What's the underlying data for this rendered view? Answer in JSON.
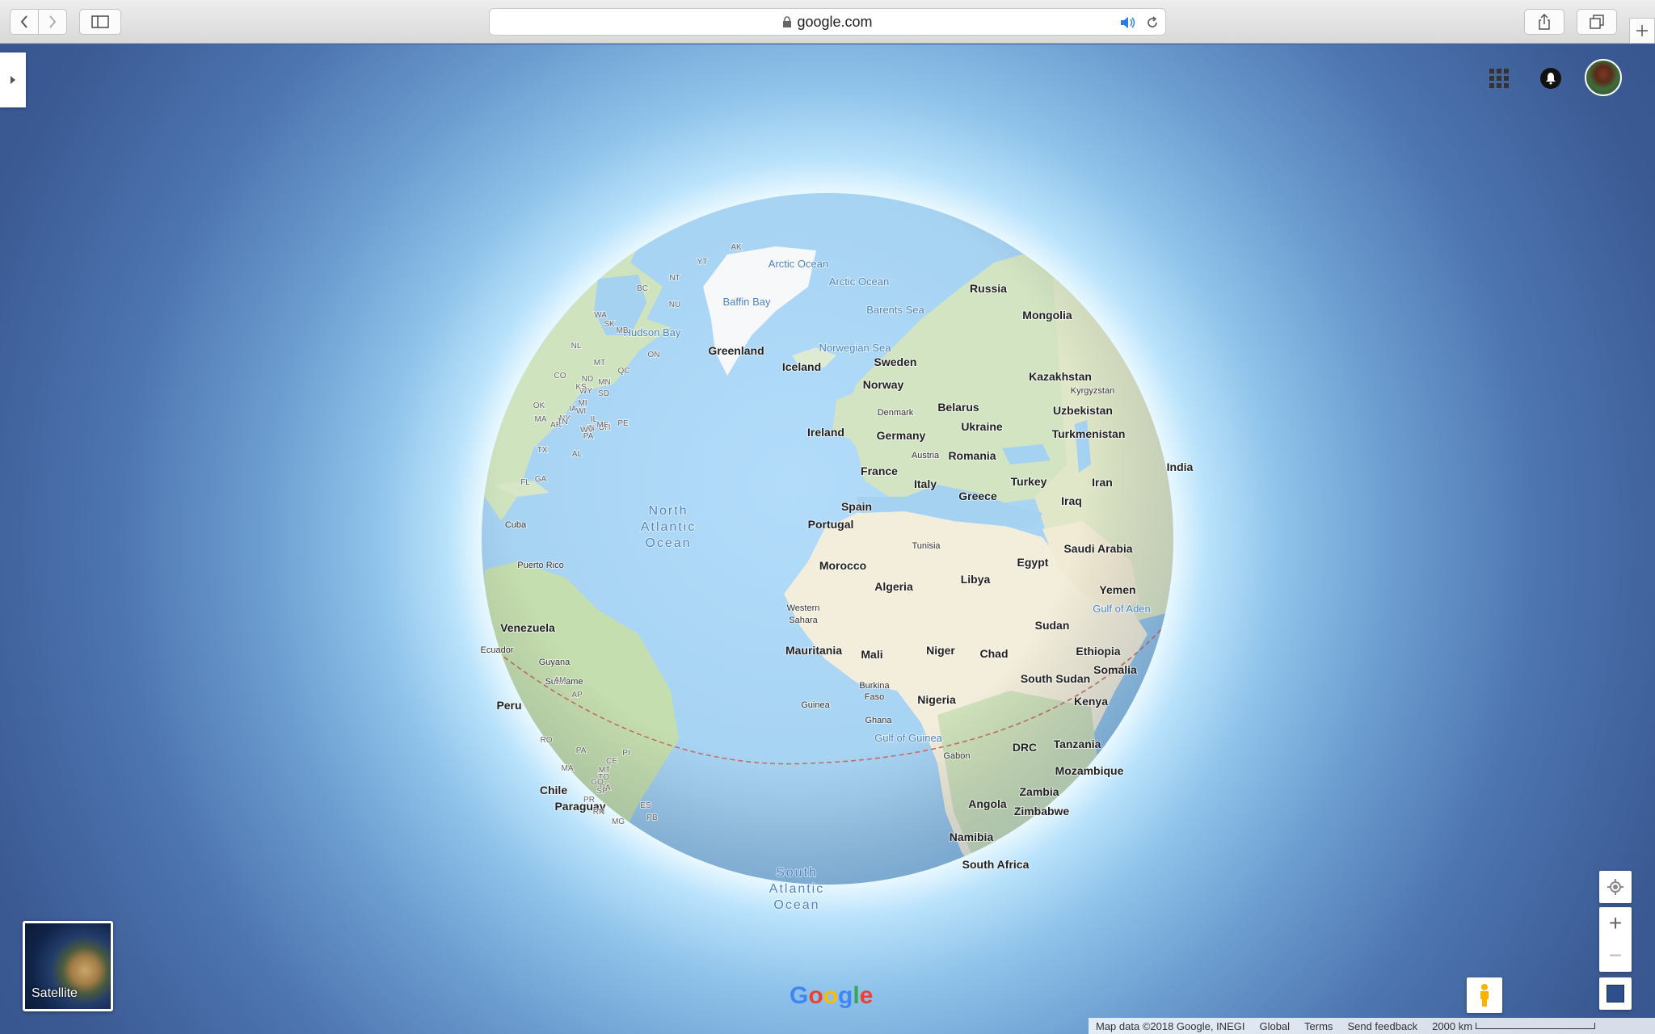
{
  "browser": {
    "url": "google.com",
    "icons": [
      "back-icon",
      "forward-icon",
      "sidebar-icon",
      "lock-icon",
      "speaker-icon",
      "reload-icon",
      "share-icon",
      "tabs-icon",
      "new-tab-icon"
    ]
  },
  "map": {
    "labels": [
      {
        "text": "Arctic Ocean",
        "kind": "water"
      },
      {
        "text": "Arctic Ocean",
        "kind": "water"
      },
      {
        "text": "Baffin Bay",
        "kind": "water"
      },
      {
        "text": "Barents Sea",
        "kind": "water"
      },
      {
        "text": "Hudson Bay",
        "kind": "water"
      },
      {
        "text": "Norwegian Sea",
        "kind": "water"
      },
      {
        "text": "North",
        "kind": "ocean"
      },
      {
        "text": "Atlantic",
        "kind": "ocean"
      },
      {
        "text": "Ocean",
        "kind": "ocean"
      },
      {
        "text": "South",
        "kind": "ocean"
      },
      {
        "text": "Atlantic",
        "kind": "ocean"
      },
      {
        "text": "Ocean",
        "kind": "ocean"
      },
      {
        "text": "Gulf of Aden",
        "kind": "water"
      },
      {
        "text": "Gulf of Guinea",
        "kind": "water"
      },
      {
        "text": "Russia",
        "kind": "country"
      },
      {
        "text": "Mongolia",
        "kind": "country"
      },
      {
        "text": "Greenland",
        "kind": "country"
      },
      {
        "text": "Iceland",
        "kind": "country"
      },
      {
        "text": "Sweden",
        "kind": "country"
      },
      {
        "text": "Norway",
        "kind": "country"
      },
      {
        "text": "Kazakhstan",
        "kind": "country"
      },
      {
        "text": "Kyrgyzstan",
        "kind": "small"
      },
      {
        "text": "Belarus",
        "kind": "country"
      },
      {
        "text": "Uzbekistan",
        "kind": "country"
      },
      {
        "text": "Denmark",
        "kind": "small"
      },
      {
        "text": "Ukraine",
        "kind": "country"
      },
      {
        "text": "Ireland",
        "kind": "country"
      },
      {
        "text": "Germany",
        "kind": "country"
      },
      {
        "text": "Turkmenistan",
        "kind": "country"
      },
      {
        "text": "Austria",
        "kind": "small"
      },
      {
        "text": "Romania",
        "kind": "country"
      },
      {
        "text": "France",
        "kind": "country"
      },
      {
        "text": "India",
        "kind": "country"
      },
      {
        "text": "Italy",
        "kind": "country"
      },
      {
        "text": "Turkey",
        "kind": "country"
      },
      {
        "text": "Iran",
        "kind": "country"
      },
      {
        "text": "Greece",
        "kind": "country"
      },
      {
        "text": "Spain",
        "kind": "country"
      },
      {
        "text": "Iraq",
        "kind": "country"
      },
      {
        "text": "Portugal",
        "kind": "country"
      },
      {
        "text": "Tunisia",
        "kind": "small"
      },
      {
        "text": "Saudi Arabia",
        "kind": "country"
      },
      {
        "text": "Egypt",
        "kind": "country"
      },
      {
        "text": "Morocco",
        "kind": "country"
      },
      {
        "text": "Libya",
        "kind": "country"
      },
      {
        "text": "Algeria",
        "kind": "country"
      },
      {
        "text": "Yemen",
        "kind": "country"
      },
      {
        "text": "Western",
        "kind": "small"
      },
      {
        "text": "Sahara",
        "kind": "small"
      },
      {
        "text": "Sudan",
        "kind": "country"
      },
      {
        "text": "Mauritania",
        "kind": "country"
      },
      {
        "text": "Mali",
        "kind": "country"
      },
      {
        "text": "Niger",
        "kind": "country"
      },
      {
        "text": "Chad",
        "kind": "country"
      },
      {
        "text": "Ethiopia",
        "kind": "country"
      },
      {
        "text": "Somalia",
        "kind": "country"
      },
      {
        "text": "South Sudan",
        "kind": "country"
      },
      {
        "text": "Burkina",
        "kind": "small"
      },
      {
        "text": "Faso",
        "kind": "small"
      },
      {
        "text": "Nigeria",
        "kind": "country"
      },
      {
        "text": "Guinea",
        "kind": "small"
      },
      {
        "text": "Ghana",
        "kind": "small"
      },
      {
        "text": "Kenya",
        "kind": "country"
      },
      {
        "text": "Tanzania",
        "kind": "country"
      },
      {
        "text": "DRC",
        "kind": "country"
      },
      {
        "text": "Gabon",
        "kind": "small"
      },
      {
        "text": "Mozambique",
        "kind": "country"
      },
      {
        "text": "Zambia",
        "kind": "country"
      },
      {
        "text": "Angola",
        "kind": "country"
      },
      {
        "text": "Zimbabwe",
        "kind": "country"
      },
      {
        "text": "Namibia",
        "kind": "country"
      },
      {
        "text": "South Africa",
        "kind": "country"
      },
      {
        "text": "Cuba",
        "kind": "small"
      },
      {
        "text": "Puerto Rico",
        "kind": "small"
      },
      {
        "text": "Venezuela",
        "kind": "country"
      },
      {
        "text": "Ecuador",
        "kind": "small"
      },
      {
        "text": "Guyana",
        "kind": "small"
      },
      {
        "text": "Suriname",
        "kind": "small"
      },
      {
        "text": "Peru",
        "kind": "country"
      },
      {
        "text": "Chile",
        "kind": "country"
      },
      {
        "text": "Paraguay",
        "kind": "country"
      },
      {
        "text": "AK",
        "kind": "state"
      },
      {
        "text": "YT",
        "kind": "state"
      },
      {
        "text": "NT",
        "kind": "state"
      },
      {
        "text": "NU",
        "kind": "state"
      },
      {
        "text": "BC",
        "kind": "state"
      },
      {
        "text": "WA",
        "kind": "state"
      },
      {
        "text": "SK",
        "kind": "state"
      },
      {
        "text": "MB",
        "kind": "state"
      },
      {
        "text": "ON",
        "kind": "state"
      },
      {
        "text": "QC",
        "kind": "state"
      },
      {
        "text": "NL",
        "kind": "state"
      },
      {
        "text": "MT",
        "kind": "state"
      },
      {
        "text": "ND",
        "kind": "state"
      },
      {
        "text": "MN",
        "kind": "state"
      },
      {
        "text": "WY",
        "kind": "state"
      },
      {
        "text": "SD",
        "kind": "state"
      },
      {
        "text": "CO",
        "kind": "state"
      },
      {
        "text": "KS",
        "kind": "state"
      },
      {
        "text": "IA",
        "kind": "state"
      },
      {
        "text": "WI",
        "kind": "state"
      },
      {
        "text": "MI",
        "kind": "state"
      },
      {
        "text": "IL",
        "kind": "state"
      },
      {
        "text": "IN",
        "kind": "state"
      },
      {
        "text": "OH",
        "kind": "state"
      },
      {
        "text": "NY",
        "kind": "state"
      },
      {
        "text": "ME",
        "kind": "state"
      },
      {
        "text": "PE",
        "kind": "state"
      },
      {
        "text": "OK",
        "kind": "state"
      },
      {
        "text": "AR",
        "kind": "state"
      },
      {
        "text": "TN",
        "kind": "state"
      },
      {
        "text": "WV",
        "kind": "state"
      },
      {
        "text": "PA",
        "kind": "state"
      },
      {
        "text": "MA",
        "kind": "state"
      },
      {
        "text": "TX",
        "kind": "state"
      },
      {
        "text": "AL",
        "kind": "state"
      },
      {
        "text": "GA",
        "kind": "state"
      },
      {
        "text": "FL",
        "kind": "state"
      },
      {
        "text": "AM",
        "kind": "state"
      },
      {
        "text": "AP",
        "kind": "state"
      },
      {
        "text": "RO",
        "kind": "state"
      },
      {
        "text": "PA",
        "kind": "state"
      },
      {
        "text": "MA",
        "kind": "state"
      },
      {
        "text": "MT",
        "kind": "state"
      },
      {
        "text": "TO",
        "kind": "state"
      },
      {
        "text": "BA",
        "kind": "state"
      },
      {
        "text": "GO",
        "kind": "state"
      },
      {
        "text": "RN",
        "kind": "state"
      },
      {
        "text": "PB",
        "kind": "state"
      },
      {
        "text": "MG",
        "kind": "state"
      },
      {
        "text": "ES",
        "kind": "state"
      },
      {
        "text": "PR",
        "kind": "state"
      },
      {
        "text": "SP",
        "kind": "state"
      },
      {
        "text": "CE",
        "kind": "state"
      },
      {
        "text": "PI",
        "kind": "state"
      }
    ]
  },
  "controls": {
    "satellite_label": "Satellite",
    "zoom_in": "+",
    "zoom_out": "−"
  },
  "logo": {
    "text": "Google",
    "colors": [
      "#4285f4",
      "#ea4335",
      "#fbbc05",
      "#4285f4",
      "#34a853",
      "#ea4335"
    ]
  },
  "footer": {
    "map_data": "Map data ©2018 Google, INEGI",
    "global": "Global",
    "terms": "Terms",
    "send_feedback": "Send feedback",
    "scale": "2000 km"
  }
}
